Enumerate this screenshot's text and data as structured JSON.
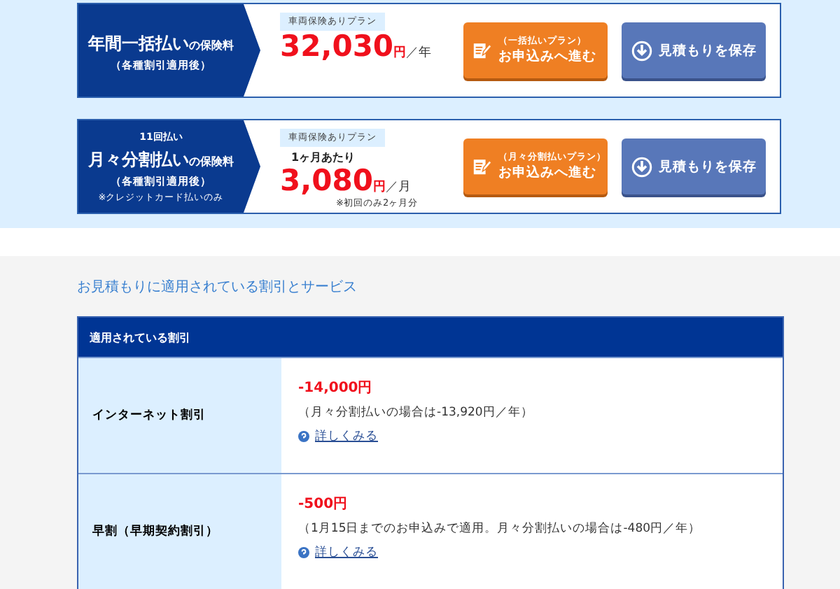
{
  "plans": [
    {
      "title": "年間一括払い",
      "title_suffix": "の保険料",
      "subtitle": "（各種割引適用後）",
      "tag": "車両保険ありプラン",
      "amount": "32,030",
      "currency": "円",
      "period": "／年",
      "apply_button": {
        "line1": "（一括払いプラン）",
        "line2": "お申込みへ進む"
      },
      "save_button": "見積もりを保存"
    },
    {
      "pre_title": "11回払い",
      "title": "月々分割払い",
      "title_suffix": "の保険料",
      "subtitle": "（各種割引適用後）",
      "left_note": "※クレジットカード払いのみ",
      "tag": "車両保険ありプラン",
      "per_label": "1ヶ月あたり",
      "amount": "3,080",
      "currency": "円",
      "period": "／月",
      "footnote": "※初回のみ2ヶ月分",
      "apply_button": {
        "line1": "（月々分割払いプラン）",
        "line2": "お申込みへ進む"
      },
      "save_button": "見積もりを保存"
    }
  ],
  "section_title": "お見積もりに適用されている割引とサービス",
  "discounts": {
    "header": "適用されている割引",
    "rows": [
      {
        "name": "インターネット割引",
        "amount": "-14,000円",
        "note": "（月々分割払いの場合は-13,920円／年）",
        "link": "詳しくみる"
      },
      {
        "name": "早割（早期契約割引）",
        "amount": "-500円",
        "note": "（1月15日までのお申込みで適用。月々分割払いの場合は-480円／年）",
        "link": "詳しくみる"
      }
    ]
  }
}
